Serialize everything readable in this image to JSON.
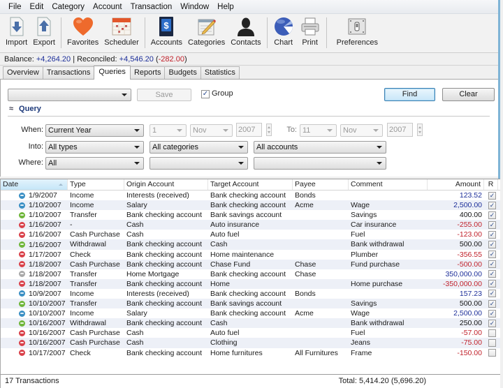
{
  "menu": [
    "File",
    "Edit",
    "Category",
    "Account",
    "Transaction",
    "Window",
    "Help"
  ],
  "toolbar": [
    {
      "label": "Import",
      "icon": "import-icon"
    },
    {
      "label": "Export",
      "icon": "export-icon"
    },
    {
      "label": "Favorites",
      "icon": "heart-icon"
    },
    {
      "label": "Scheduler",
      "icon": "calendar-icon"
    },
    {
      "label": "Accounts",
      "icon": "dollar-book-icon"
    },
    {
      "label": "Categories",
      "icon": "pencil-notepad-icon"
    },
    {
      "label": "Contacts",
      "icon": "person-icon"
    },
    {
      "label": "Chart",
      "icon": "pie-chart-icon"
    },
    {
      "label": "Print",
      "icon": "printer-icon"
    },
    {
      "label": "Preferences",
      "icon": "switch-icon"
    }
  ],
  "balance": {
    "balance_label": "Balance:",
    "balance_value": "+4,264.20",
    "separator": "|",
    "reconciled_label": "Reconciled:",
    "reconciled_value": "+4,546.20",
    "difference": "-282.00"
  },
  "tabs": [
    "Overview",
    "Transactions",
    "Queries",
    "Reports",
    "Budgets",
    "Statistics"
  ],
  "active_tab": "Queries",
  "query": {
    "saved_query_value": "",
    "save_label": "Save",
    "group_label": "Group",
    "group_checked": true,
    "find_label": "Find",
    "clear_label": "Clear",
    "section_title": "Query",
    "when_label": "When:",
    "when_value": "Current Year",
    "from_day": "1",
    "from_month": "Nov",
    "from_year": "2007",
    "to_label": "To:",
    "to_day": "11",
    "to_month": "Nov",
    "to_year": "2007",
    "into_label": "Into:",
    "into_type": "All types",
    "into_category": "All categories",
    "into_account": "All accounts",
    "where_label": "Where:",
    "where_value": "All",
    "where_field2": "",
    "where_field3": ""
  },
  "table": {
    "columns": [
      "Date",
      "Type",
      "Origin Account",
      "Target Account",
      "Payee",
      "Comment",
      "Amount",
      "R"
    ],
    "status_colors": {
      "blue": "#3a8fc4",
      "green": "#6fb63a",
      "red": "#d9414a",
      "gray": "#a9a9a9"
    },
    "rows": [
      {
        "status": "blue",
        "date": "1/9/2007",
        "type": "Income",
        "origin": "Interests (received)",
        "target": "Bank checking account",
        "payee": "Bonds",
        "comment": "",
        "amount": "123.52",
        "amount_kind": "income",
        "reconciled": true
      },
      {
        "status": "blue",
        "date": "1/10/2007",
        "type": "Income",
        "origin": "Salary",
        "target": "Bank checking account",
        "payee": "Acme",
        "comment": "Wage",
        "amount": "2,500.00",
        "amount_kind": "income",
        "reconciled": true
      },
      {
        "status": "green",
        "date": "1/10/2007",
        "type": "Transfer",
        "origin": "Bank checking account",
        "target": "Bank savings account",
        "payee": "",
        "comment": "Savings",
        "amount": "400.00",
        "amount_kind": "transfer",
        "reconciled": true
      },
      {
        "status": "red",
        "date": "1/16/2007",
        "type": "-",
        "origin": "Cash",
        "target": "Auto insurance",
        "payee": "",
        "comment": "Car insurance",
        "amount": "-255.00",
        "amount_kind": "expense",
        "reconciled": true
      },
      {
        "status": "red",
        "date": "1/16/2007",
        "type": "Cash Purchase",
        "origin": "Cash",
        "target": "Auto fuel",
        "payee": "",
        "comment": "Fuel",
        "amount": "-123.00",
        "amount_kind": "expense",
        "reconciled": true
      },
      {
        "status": "green",
        "date": "1/16/2007",
        "type": "Withdrawal",
        "origin": "Bank checking account",
        "target": "Cash",
        "payee": "",
        "comment": "Bank withdrawal",
        "amount": "500.00",
        "amount_kind": "transfer",
        "reconciled": true
      },
      {
        "status": "red",
        "date": "1/17/2007",
        "type": "Check",
        "origin": "Bank checking account",
        "target": "Home maintenance",
        "payee": "",
        "comment": "Plumber",
        "amount": "-356.55",
        "amount_kind": "expense",
        "reconciled": true
      },
      {
        "status": "red",
        "date": "1/18/2007",
        "type": "Cash Purchase",
        "origin": "Bank checking account",
        "target": "Chase Fund",
        "payee": "Chase",
        "comment": "Fund purchase",
        "amount": "-500.00",
        "amount_kind": "expense",
        "reconciled": true
      },
      {
        "status": "gray",
        "date": "1/18/2007",
        "type": "Transfer",
        "origin": "Home Mortgage",
        "target": "Bank checking account",
        "payee": "Chase",
        "comment": "",
        "amount": "350,000.00",
        "amount_kind": "income",
        "reconciled": true
      },
      {
        "status": "red",
        "date": "1/18/2007",
        "type": "Transfer",
        "origin": "Bank checking account",
        "target": "Home",
        "payee": "",
        "comment": "Home purchase",
        "amount": "-350,000.00",
        "amount_kind": "expense",
        "reconciled": true
      },
      {
        "status": "blue",
        "date": "10/9/2007",
        "type": "Income",
        "origin": "Interests (received)",
        "target": "Bank checking account",
        "payee": "Bonds",
        "comment": "",
        "amount": "157.23",
        "amount_kind": "income",
        "reconciled": true
      },
      {
        "status": "green",
        "date": "10/10/2007",
        "type": "Transfer",
        "origin": "Bank checking account",
        "target": "Bank savings account",
        "payee": "",
        "comment": "Savings",
        "amount": "500.00",
        "amount_kind": "transfer",
        "reconciled": true
      },
      {
        "status": "blue",
        "date": "10/10/2007",
        "type": "Income",
        "origin": "Salary",
        "target": "Bank checking account",
        "payee": "Acme",
        "comment": "Wage",
        "amount": "2,500.00",
        "amount_kind": "income",
        "reconciled": true
      },
      {
        "status": "green",
        "date": "10/16/2007",
        "type": "Withdrawal",
        "origin": "Bank checking account",
        "target": "Cash",
        "payee": "",
        "comment": "Bank withdrawal",
        "amount": "250.00",
        "amount_kind": "transfer",
        "reconciled": true
      },
      {
        "status": "red",
        "date": "10/16/2007",
        "type": "Cash Purchase",
        "origin": "Cash",
        "target": "Auto fuel",
        "payee": "",
        "comment": "Fuel",
        "amount": "-57.00",
        "amount_kind": "expense",
        "reconciled": false
      },
      {
        "status": "red",
        "date": "10/16/2007",
        "type": "Cash Purchase",
        "origin": "Cash",
        "target": "Clothing",
        "payee": "",
        "comment": "Jeans",
        "amount": "-75.00",
        "amount_kind": "expense",
        "reconciled": false
      },
      {
        "status": "red",
        "date": "10/17/2007",
        "type": "Check",
        "origin": "Bank checking account",
        "target": "Home furnitures",
        "payee": "All Furnitures",
        "comment": "Frame",
        "amount": "-150.00",
        "amount_kind": "expense",
        "reconciled": false
      }
    ],
    "amount_colors": {
      "income": "#1c2e99",
      "transfer": "#111111",
      "expense": "#c0202a"
    }
  },
  "status_bar": {
    "count": "17 Transactions",
    "total": "Total: 5,414.20 (5,696.20)"
  }
}
